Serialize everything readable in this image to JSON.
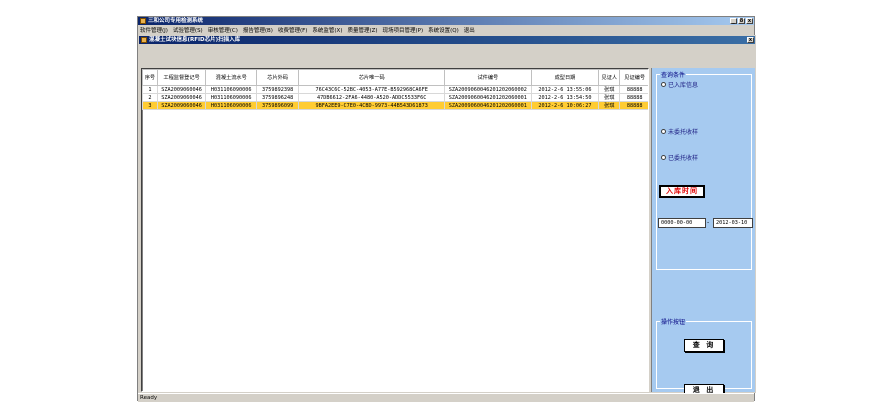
{
  "app": {
    "title": "三和公司专用检测系统",
    "window_buttons": [
      "_",
      "8",
      "x"
    ]
  },
  "menu": [
    "软件管理(J)",
    "试验管理(S)",
    "审核管理(C)",
    "报告管理(B)",
    "收费管理(F)",
    "系统监管(X)",
    "质量管理(Z)",
    "现场项目管理(P)",
    "系统设置(Q)",
    "退出"
  ],
  "child": {
    "title": "混凝土试块信息(RFID芯片)扫描入库",
    "close_label": "x"
  },
  "table": {
    "columns": [
      "序号",
      "工程监督登记号",
      "混凝土流水号",
      "芯片外码",
      "芯片唯一码",
      "试件编号",
      "成型日期",
      "见证人",
      "见证编号"
    ],
    "rows": [
      [
        "1",
        "SZA2009060046",
        "H031106090006",
        "3759892398",
        "76C43C6C-52BC-4053-A77E-B592968CA6FE",
        "SZA2009060046201202060002",
        "2012-2-6 13:55:06",
        "张琪",
        "88888"
      ],
      [
        "2",
        "SZA2009060046",
        "H031106090006",
        "3759896248",
        "47DB6612-2FA6-4480-A520-ADDC5533F6C",
        "SZA2009060046201202060001",
        "2012-2-6 13:54:50",
        "张琪",
        "88888"
      ],
      [
        "3",
        "SZA2009060046",
        "H031106090006",
        "3759896099",
        "9BFA2EE9-C7E0-4CBD-9973-44B543D61873",
        "SZA2009060046201202060001",
        "2012-2-6 10:06:27",
        "张琪",
        "88888"
      ]
    ],
    "selected_row": 3
  },
  "side": {
    "query_group_label": "查询条件",
    "radio_in_stock": "已入库信息",
    "radio_not_commissioned": "未委托收样",
    "radio_commissioned": "已委托收样",
    "in_time_label": "入库时间",
    "date_from": "0000-00-00",
    "date_to": "2012-03-10",
    "date_dash": "-",
    "ops_group_label": "操作按钮",
    "query_button": "查 询",
    "exit_button": "退 出"
  },
  "status": {
    "text": "Ready"
  },
  "colors": {
    "selected_row": "#ffcc33",
    "side_panel": "#a6caf0",
    "in_time_text": "#e00000"
  }
}
